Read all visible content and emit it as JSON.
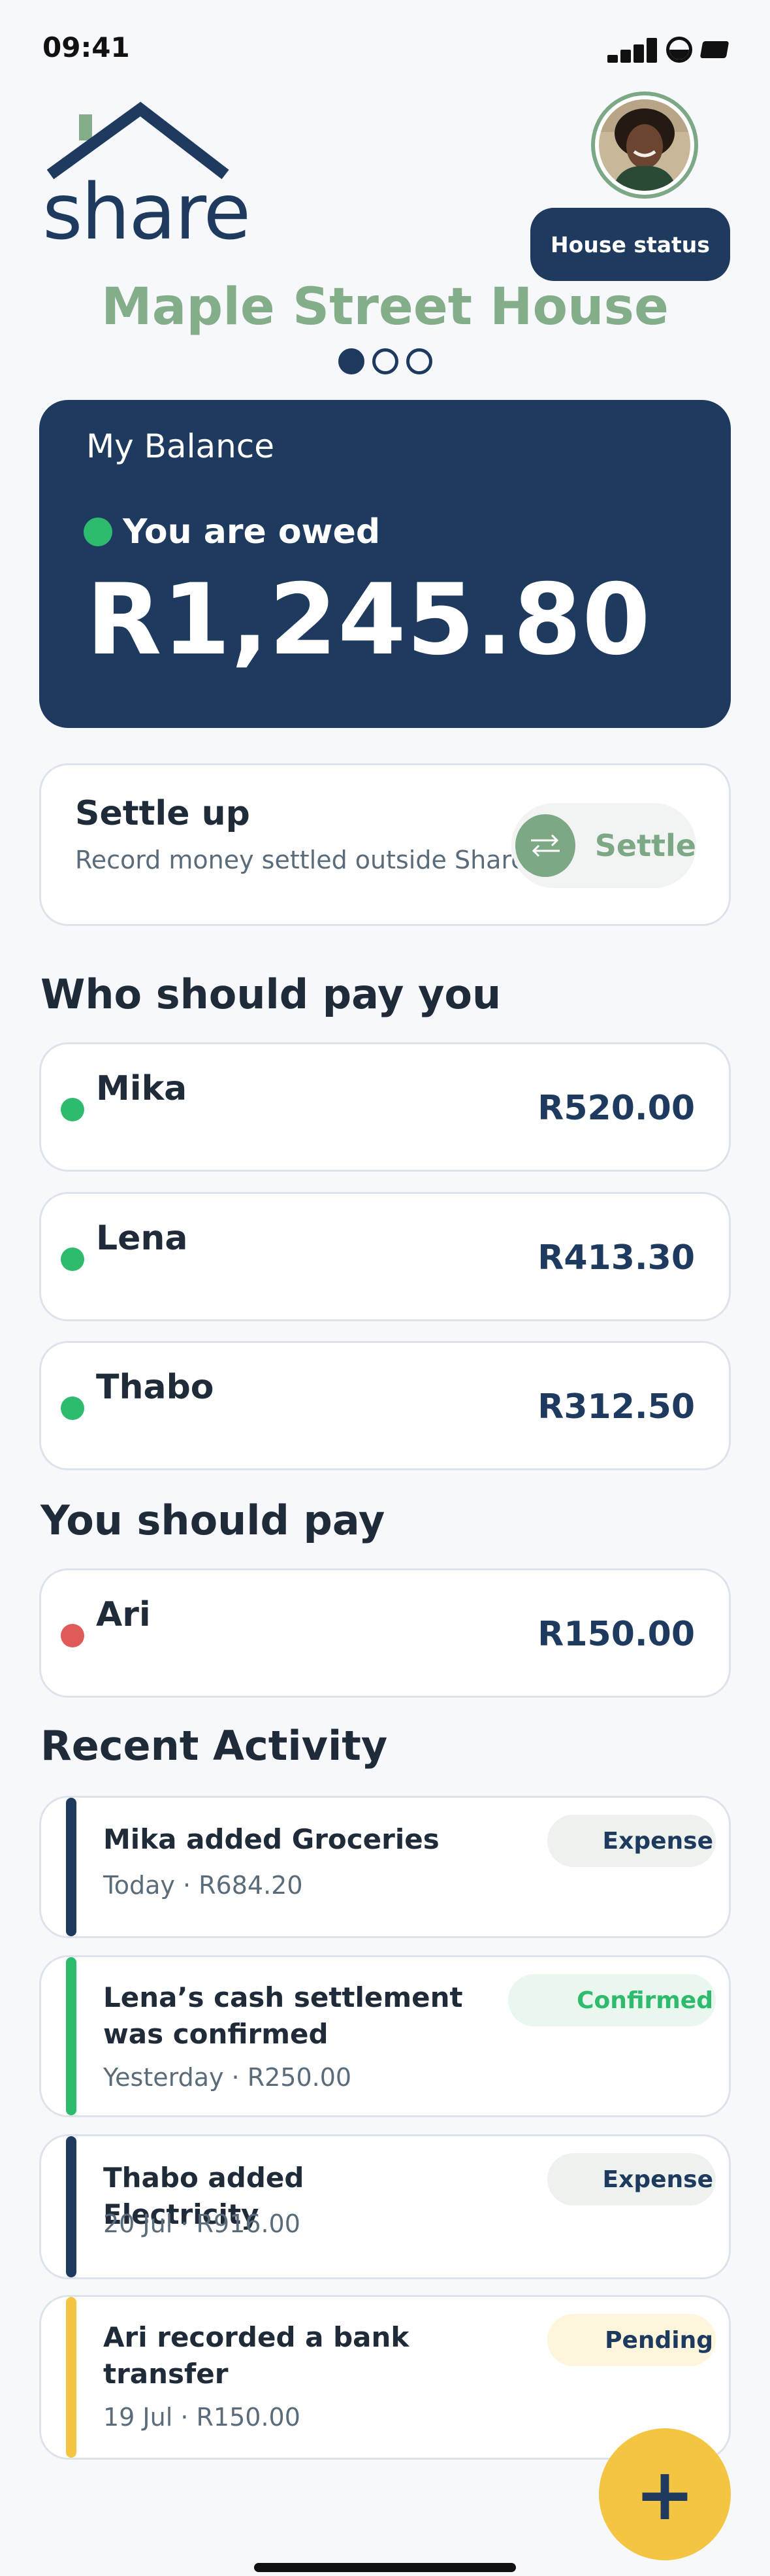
{
  "status_bar": {
    "time": "09:41"
  },
  "header": {
    "logo_text": "share",
    "house_status_label": "House status",
    "house_name": "Maple Street House"
  },
  "balance": {
    "title": "My Balance",
    "status": "You are owed",
    "amount": "R1,245.80"
  },
  "settle": {
    "title": "Settle up",
    "subtitle": "Record money settled outside Share.",
    "button_label": "Settle"
  },
  "who_pays_you": {
    "title": "Who should pay you",
    "items": [
      {
        "name": "Mika",
        "amount": "R520.00"
      },
      {
        "name": "Lena",
        "amount": "R413.30"
      },
      {
        "name": "Thabo",
        "amount": "R312.50"
      }
    ]
  },
  "you_pay": {
    "title": "You should pay",
    "items": [
      {
        "name": "Ari",
        "amount": "R150.00"
      }
    ]
  },
  "activity": {
    "title": "Recent Activity",
    "items": [
      {
        "title": "Mika added Groceries",
        "sub": "Today · R684.20",
        "badge": "Expense"
      },
      {
        "title": "Lena’s cash settlement was confirmed",
        "sub": "Yesterday · R250.00",
        "badge": "Confirmed"
      },
      {
        "title": "Thabo added Electricity",
        "sub": "20 Jul · R916.00",
        "badge": "Expense"
      },
      {
        "title": "Ari recorded a bank transfer",
        "sub": "19 Jul · R150.00",
        "badge": "Pending"
      }
    ]
  },
  "fab_label": "+",
  "colors": {
    "navy": "#1e3a5f",
    "sage": "#84ae89",
    "positive": "#2ebb6e",
    "negative": "#e05a5a",
    "pending": "#f4c542",
    "background": "#f6f8fb"
  },
  "icons": [
    "signal-icon",
    "wifi-icon",
    "battery-icon",
    "house-logo-icon",
    "swap-arrows-icon",
    "plus-icon"
  ]
}
